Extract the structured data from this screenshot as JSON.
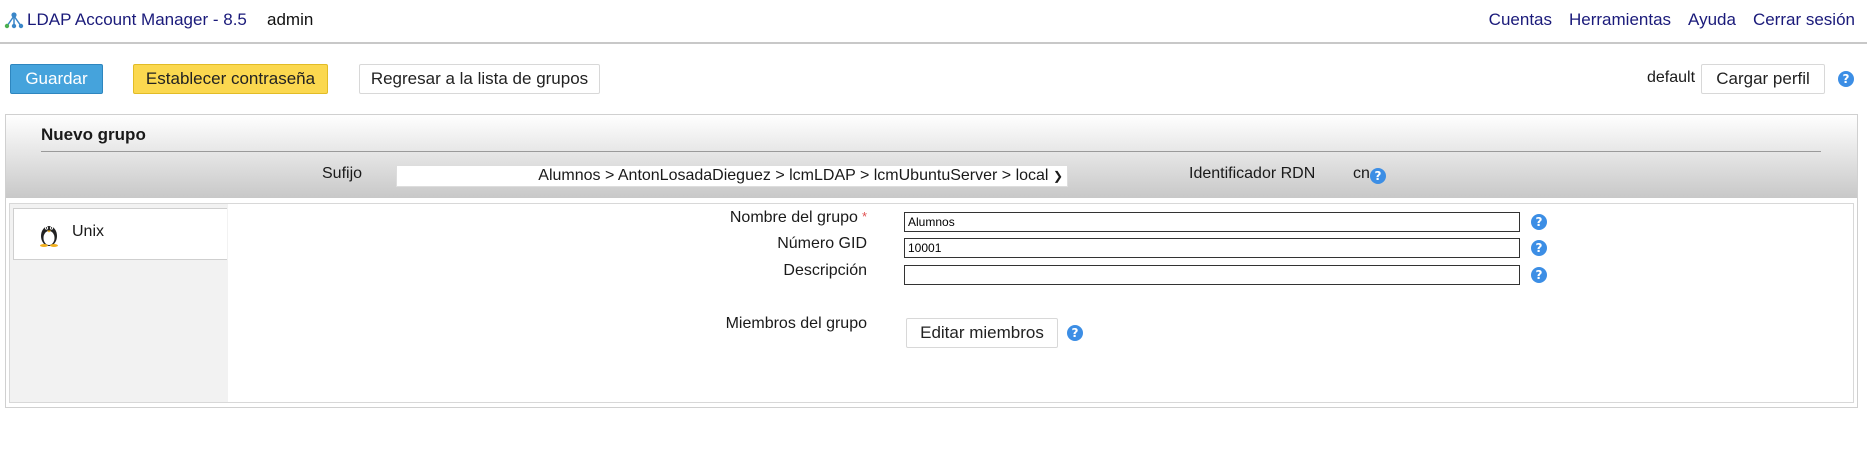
{
  "topbar": {
    "logo_icon": "lam-logo-icon",
    "app_title": "LDAP Account Manager - 8.5",
    "user": "admin",
    "nav": [
      "Cuentas",
      "Herramientas",
      "Ayuda",
      "Cerrar sesión"
    ]
  },
  "toolbar": {
    "save_label": "Guardar",
    "set_password_label": "Establecer contraseña",
    "back_label": "Regresar a la lista de grupos",
    "profile_label": "default",
    "load_profile_label": "Cargar perfil"
  },
  "panel": {
    "title": "Nuevo grupo",
    "suffix_label": "Sufijo",
    "suffix_value": "Alumnos > AntonLosadaDieguez > lcmLDAP > lcmUbuntuServer > local",
    "rdn_label": "Identificador RDN",
    "rdn_value": "cn"
  },
  "tabs": [
    {
      "label": "Unix",
      "icon": "penguin-icon"
    }
  ],
  "form": {
    "group_name_label": "Nombre del grupo",
    "group_name_required": "*",
    "group_name_value": "Alumnos",
    "gid_label": "Número GID",
    "gid_value": "10001",
    "description_label": "Descripción",
    "description_value": "",
    "members_label": "Miembros del grupo",
    "edit_members_label": "Editar miembros"
  },
  "colors": {
    "primary_button": "#45a3dc",
    "warning_button": "#fbd84f",
    "help_icon": "#3c8ee5",
    "link": "#1a1a7a"
  }
}
